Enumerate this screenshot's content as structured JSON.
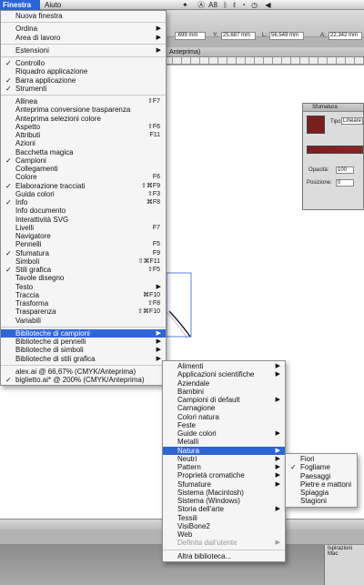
{
  "menubar": {
    "active": "Finestra",
    "next": "Aiuto",
    "tray_label": "A8"
  },
  "control_bar": {
    "field_1": ",699 mm",
    "y_label": "Y:",
    "y_value": "25,687 mm",
    "l_label": "L:",
    "l_value": "56,549 mm",
    "a_label": "A:",
    "a_value": "22,342 mm"
  },
  "tab_bar": {
    "label": "Anteprima)"
  },
  "gradient_panel": {
    "title": "Sfumatura",
    "type_label": "Tipo:",
    "type_value": "Lineare",
    "opacity_label": "Opacità:",
    "opacity_value": "100",
    "position_label": "Posizione:",
    "position_value": "0",
    "colors": {
      "swatch": "#7a1f1f"
    }
  },
  "dock_panel": {
    "label": "Ispirazioni Mac"
  },
  "finestra_menu": {
    "items": [
      {
        "label": "Nuova finestra"
      },
      {
        "sep": true
      },
      {
        "label": "Ordina",
        "submenu": true
      },
      {
        "label": "Area di lavoro",
        "submenu": true
      },
      {
        "sep": true
      },
      {
        "label": "Estensioni",
        "submenu": true
      },
      {
        "sep": true
      },
      {
        "label": "Controllo",
        "checked": true
      },
      {
        "label": "Riquadro applicazione"
      },
      {
        "label": "Barra applicazione",
        "checked": true
      },
      {
        "label": "Strumenti",
        "checked": true
      },
      {
        "sep": true
      },
      {
        "label": "Allinea",
        "shortcut": "⇧F7"
      },
      {
        "label": "Anteprima conversione trasparenza"
      },
      {
        "label": "Anteprima selezioni colore"
      },
      {
        "label": "Aspetto",
        "shortcut": "⇧F6"
      },
      {
        "label": "Attributi",
        "shortcut": "F11"
      },
      {
        "label": "Azioni"
      },
      {
        "label": "Bacchetta magica"
      },
      {
        "label": "Campioni",
        "checked": true
      },
      {
        "label": "Collegamenti"
      },
      {
        "label": "Colore",
        "shortcut": "F6"
      },
      {
        "label": "Elaborazione tracciati",
        "checked": true,
        "shortcut": "⇧⌘F9"
      },
      {
        "label": "Guida colori",
        "shortcut": "⇧F3"
      },
      {
        "label": "Info",
        "checked": true,
        "shortcut": "⌘F8"
      },
      {
        "label": "Info documento"
      },
      {
        "label": "Interattività SVG"
      },
      {
        "label": "Livelli",
        "shortcut": "F7"
      },
      {
        "label": "Navigatore"
      },
      {
        "label": "Pennelli",
        "shortcut": "F5"
      },
      {
        "label": "Sfumatura",
        "checked": true,
        "shortcut": "F9"
      },
      {
        "label": "Simboli",
        "shortcut": "⇧⌘F11"
      },
      {
        "label": "Stili grafica",
        "checked": true,
        "shortcut": "⇧F5"
      },
      {
        "label": "Tavole disegno"
      },
      {
        "label": "Testo",
        "submenu": true
      },
      {
        "label": "Traccia",
        "shortcut": "⌘F10"
      },
      {
        "label": "Trasforma",
        "shortcut": "⇧F8"
      },
      {
        "label": "Trasparenza",
        "shortcut": "⇧⌘F10"
      },
      {
        "label": "Variabili"
      },
      {
        "sep": true
      },
      {
        "label": "Biblioteche di campioni",
        "submenu": true,
        "highlighted": true
      },
      {
        "label": "Biblioteche di pennelli",
        "submenu": true
      },
      {
        "label": "Biblioteche di simboli",
        "submenu": true
      },
      {
        "label": "Biblioteche di stili grafica",
        "submenu": true
      },
      {
        "sep": true
      },
      {
        "label": "alex.ai @ 66,67% (CMYK/Anteprima)"
      },
      {
        "label": "biglietto.ai* @ 200% (CMYK/Anteprima)",
        "checked": true
      }
    ]
  },
  "campioni_menu": {
    "items": [
      {
        "label": "Alimenti",
        "submenu": true
      },
      {
        "label": "Applicazioni scientifiche",
        "submenu": true
      },
      {
        "label": "Aziendale"
      },
      {
        "label": "Bambini"
      },
      {
        "label": "Campioni di default",
        "submenu": true
      },
      {
        "label": "Carnagione"
      },
      {
        "label": "Colori natura"
      },
      {
        "label": "Feste"
      },
      {
        "label": "Guide colori",
        "submenu": true
      },
      {
        "label": "Metalli"
      },
      {
        "label": "Natura",
        "submenu": true,
        "highlighted": true
      },
      {
        "label": "Neutri",
        "submenu": true
      },
      {
        "label": "Pattern",
        "submenu": true
      },
      {
        "label": "Proprietà cromatiche",
        "submenu": true
      },
      {
        "label": "Sfumature",
        "submenu": true
      },
      {
        "label": "Sistema (Macintosh)"
      },
      {
        "label": "Sistema (Windows)"
      },
      {
        "label": "Storia dell'arte",
        "submenu": true
      },
      {
        "label": "Tessili"
      },
      {
        "label": "VisiBone2"
      },
      {
        "label": "Web"
      },
      {
        "label": "Definita dall'utente",
        "submenu": true,
        "disabled": true
      },
      {
        "sep": true
      },
      {
        "label": "Altra biblioteca..."
      }
    ]
  },
  "natura_menu": {
    "items": [
      {
        "label": "Fiori"
      },
      {
        "label": "Fogliame",
        "checked": true
      },
      {
        "label": "Paesaggi"
      },
      {
        "label": "Pietre e mattoni"
      },
      {
        "label": "Spiaggia"
      },
      {
        "label": "Stagioni"
      }
    ]
  },
  "colors": {
    "highlight": "#2f66d6",
    "menu_bg": "#f5f5f5"
  }
}
